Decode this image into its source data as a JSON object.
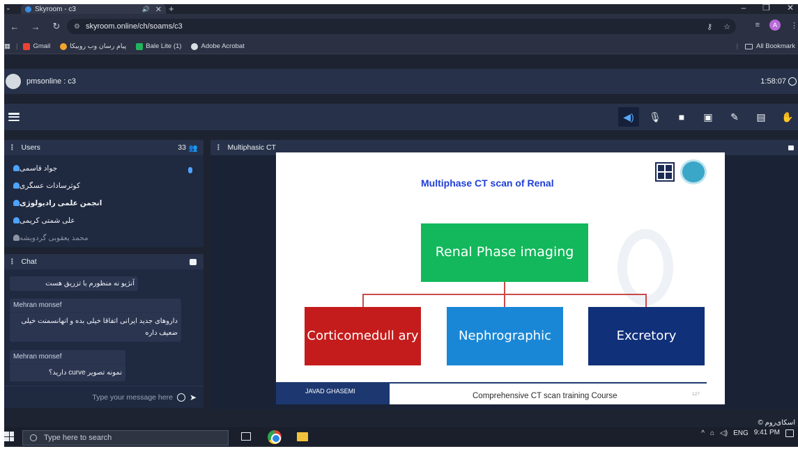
{
  "browser": {
    "tab_title": "Skyroom - c3",
    "url": "skyroom.online/ch/soams/c3",
    "profile_initial": "A",
    "bookmarks": [
      {
        "label": "Gmail",
        "color": "#ea4335"
      },
      {
        "label": "پیام رسان وب روبیکا",
        "color": "#f0a52c"
      },
      {
        "label": "Bale Lite (1)",
        "color": "#22b35e"
      },
      {
        "label": "Adobe Acrobat",
        "color": "#d9dde5"
      }
    ],
    "all_bookmarks": "All Bookmark"
  },
  "app": {
    "room_name": "pmsonline : c3",
    "timer": "1:58:07"
  },
  "users_panel": {
    "title": "Users",
    "count": "33",
    "users": [
      {
        "name": "جواد قاسمی",
        "style": "normal"
      },
      {
        "name": "کوثرسادات عسگری",
        "style": "normal"
      },
      {
        "name": "انجمن علمی رادیولوژی",
        "style": "bold"
      },
      {
        "name": "علی شمتی کریمی",
        "style": "normal"
      },
      {
        "name": "محمد یعقوبی گردویشه",
        "style": "dim"
      }
    ]
  },
  "chat_panel": {
    "title": "Chat",
    "messages": [
      {
        "sender": "",
        "text": "آنژیو نه منظورم با تزریق هست"
      },
      {
        "sender": "Mehran monsef",
        "text": "داروهای جدید ایرانی اتفاقا خیلی بده و انهانسمنت خیلی ضعیف داره"
      },
      {
        "sender": "Mehran monsef",
        "text": "نمونه تصویر curve دارید؟"
      }
    ],
    "input_placeholder": "Type your message here"
  },
  "presentation": {
    "panel_title": "Multiphasic CT",
    "slide": {
      "title": "Multiphase CT scan of Renal",
      "main_box": "Renal Phase imaging",
      "boxes": [
        "Corticomedull ary",
        "Nephrographic",
        "Excretory"
      ],
      "footer_author": "JAVAD GHASEMI",
      "footer_course": "Comprehensive CT scan training Course",
      "page_number": "127"
    }
  },
  "brand": "اسکای‌روم ©",
  "taskbar": {
    "search_placeholder": "Type here to search",
    "lang": "ENG",
    "time": "9:41 PM"
  }
}
